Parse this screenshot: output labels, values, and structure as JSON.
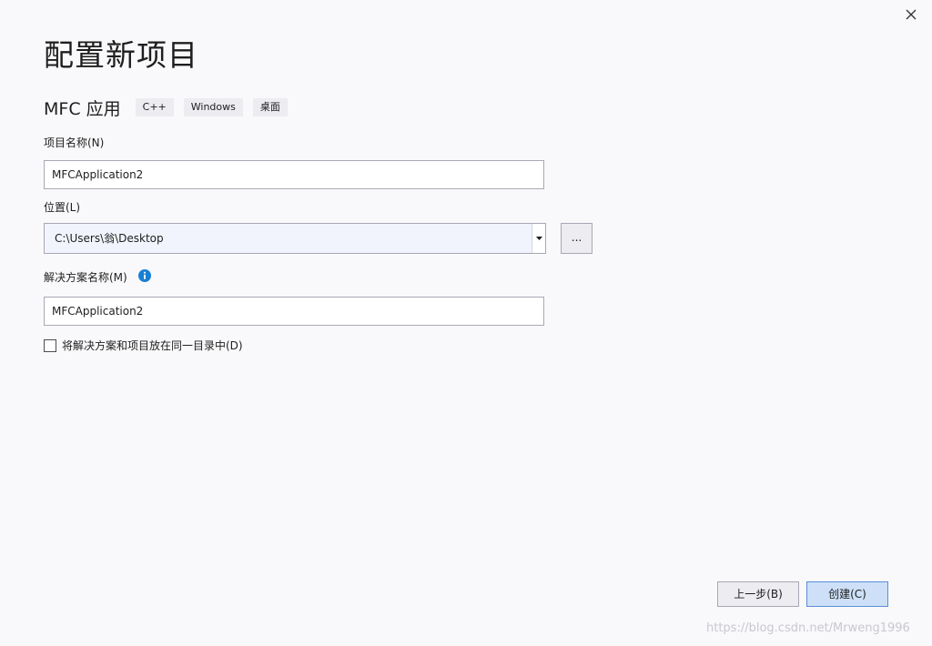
{
  "dialog": {
    "title": "配置新项目"
  },
  "template": {
    "name": "MFC 应用",
    "tags": [
      "C++",
      "Windows",
      "桌面"
    ]
  },
  "fields": {
    "project_name": {
      "label": "项目名称(N)",
      "value": "MFCApplication2"
    },
    "location": {
      "label": "位置(L)",
      "value": "C:\\Users\\翁\\Desktop",
      "browse_label": "..."
    },
    "solution_name": {
      "label": "解决方案名称(M)",
      "value": "MFCApplication2"
    }
  },
  "checkbox": {
    "label": "将解决方案和项目放在同一目录中(D)",
    "checked": false
  },
  "buttons": {
    "back": "上一步(B)",
    "create": "创建(C)"
  },
  "watermark": "https://blog.csdn.net/Mrweng1996",
  "colors": {
    "background": "#f9f9fb",
    "accent": "#1a7fd4",
    "primary_button": "#cde0f7"
  }
}
